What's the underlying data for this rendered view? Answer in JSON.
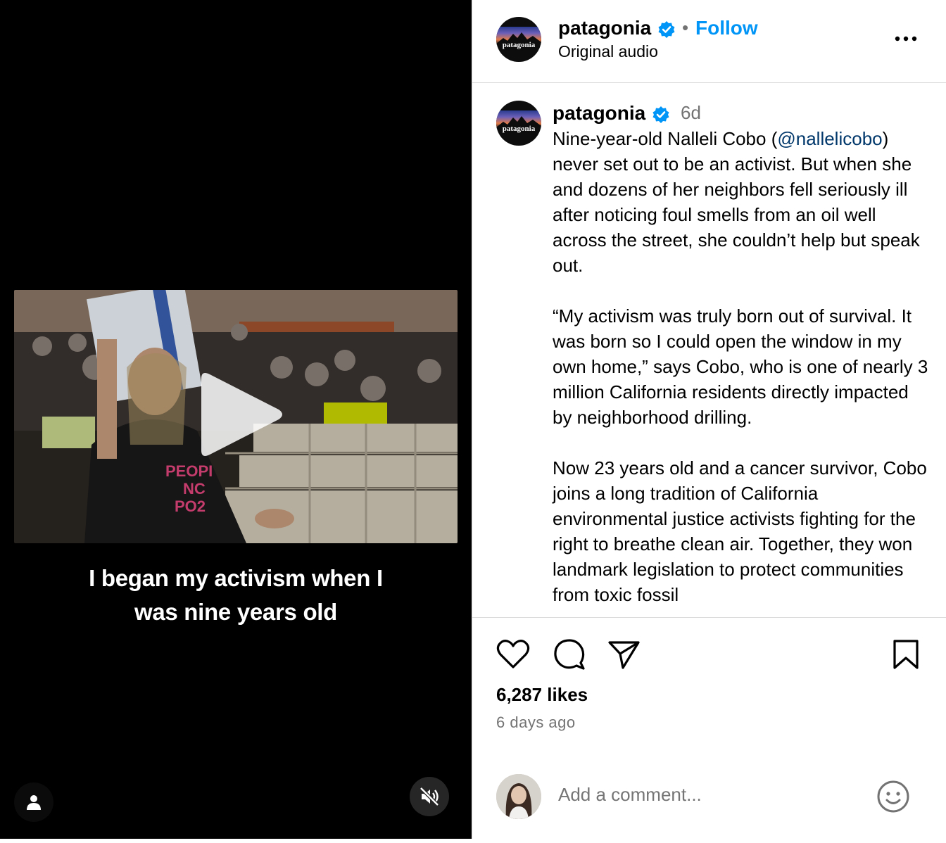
{
  "video": {
    "caption_line1": "I began my activism when I",
    "caption_line2": "was nine years old"
  },
  "header": {
    "username": "patagonia",
    "separator": "•",
    "follow_label": "Follow",
    "audio_label": "Original audio",
    "avatar_text": "patagonia"
  },
  "post": {
    "username": "patagonia",
    "time": "6d",
    "paragraph1_before": "Nine-year-old Nalleli Cobo (",
    "mention": "@nallelicobo",
    "paragraph1_after": ") never set out to be an activist. But when she and dozens of her neighbors fell seriously ill after noticing foul smells from an oil well across the street, she couldn’t help but speak out.",
    "paragraph2": "“My activism was truly born out of survival. It was born so I could open the window in my own home,” says Cobo, who is one of nearly 3 million California residents directly impacted by neighborhood drilling.",
    "paragraph3": "Now 23 years old and a cancer survivor, Cobo joins a long tradition of California environmental justice activists fighting for the right to breathe clean air. Together, they won landmark legislation to protect communities from toxic fossil"
  },
  "actions": {
    "likes": "6,287 likes",
    "time_ago": "6 days ago"
  },
  "comment": {
    "placeholder": "Add a comment..."
  },
  "icons": {
    "verified": "verified-badge-icon",
    "more": "more-options-icon",
    "like": "heart-icon",
    "comment": "comment-bubble-icon",
    "share": "paper-plane-icon",
    "save": "bookmark-icon",
    "emoji": "smiley-icon",
    "user": "user-icon",
    "mute": "speaker-muted-icon",
    "play": "play-icon"
  },
  "colors": {
    "accent": "#0095f6",
    "verified": "#0095f6",
    "mention": "#00376b",
    "muted_text": "#737373",
    "border": "#dbdbdb"
  }
}
